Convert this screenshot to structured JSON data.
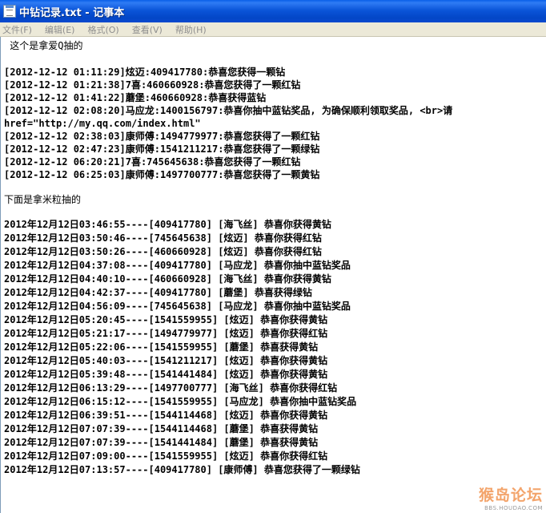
{
  "window": {
    "title": "中钻记录.txt - 记事本"
  },
  "menu": [
    {
      "label": "文件(F)"
    },
    {
      "label": "编辑(E)"
    },
    {
      "label": "格式(O)"
    },
    {
      "label": "查看(V)"
    },
    {
      "label": "帮助(H)"
    }
  ],
  "content": {
    "lines": [
      " 这个是拿爱Q抽的",
      "",
      "[2012-12-12 01:11:29]炫迈:409417780:恭喜您获得一颗钻",
      "[2012-12-12 01:21:38]7喜:460660928:恭喜您获得了一颗红钻",
      "[2012-12-12 01:41:22]蘑堡:460660928:恭喜获得蓝钻",
      "[2012-12-12 02:08:20]马应龙:1400156797:恭喜你抽中蓝钻奖品, 为确保顺利领取奖品, <br>请",
      "href=\"http://my.qq.com/index.html\"",
      "[2012-12-12 02:38:03]康师傅:1494779977:恭喜您获得了一颗红钻",
      "[2012-12-12 02:47:23]康师傅:1541211217:恭喜您获得了一颗绿钻",
      "[2012-12-12 06:20:21]7喜:745645638:恭喜您获得了一颗红钻",
      "[2012-12-12 06:25:03]康师傅:1497700777:恭喜您获得了一颗黄钻",
      "",
      "下面是拿米粒抽的",
      "",
      "2012年12月12日03:46:55----[409417780] [海飞丝] 恭喜你获得黄钻",
      "2012年12月12日03:50:46----[745645638] [炫迈] 恭喜你获得红钻",
      "2012年12月12日03:50:26----[460660928] [炫迈] 恭喜你获得红钻",
      "2012年12月12日04:37:08----[409417780] [马应龙] 恭喜你抽中蓝钻奖品",
      "2012年12月12日04:40:10----[460660928] [海飞丝] 恭喜你获得黄钻",
      "2012年12月12日04:42:37----[409417780] [蘑堡] 恭喜获得绿钻",
      "2012年12月12日04:56:09----[745645638] [马应龙] 恭喜你抽中蓝钻奖品",
      "2012年12月12日05:20:45----[1541559955] [炫迈] 恭喜你获得黄钻",
      "2012年12月12日05:21:17----[1494779977] [炫迈] 恭喜你获得红钻",
      "2012年12月12日05:22:06----[1541559955] [蘑堡] 恭喜获得黄钻",
      "2012年12月12日05:40:03----[1541211217] [炫迈] 恭喜你获得黄钻",
      "2012年12月12日05:39:48----[1541441484] [炫迈] 恭喜你获得黄钻",
      "2012年12月12日06:13:29----[1497700777] [海飞丝] 恭喜你获得红钻",
      "2012年12月12日06:15:12----[1541559955] [马应龙] 恭喜你抽中蓝钻奖品",
      "2012年12月12日06:39:51----[1544114468] [炫迈] 恭喜你获得黄钻",
      "2012年12月12日07:07:39----[1544114468] [蘑堡] 恭喜获得黄钻",
      "2012年12月12日07:07:39----[1541441484] [蘑堡] 恭喜获得黄钻",
      "2012年12月12日07:09:00----[1541559955] [炫迈] 恭喜你获得红钻",
      "2012年12月12日07:13:57----[409417780] [康师傅] 恭喜您获得了一颗绿钻"
    ]
  },
  "watermark": {
    "main": "猴岛论坛",
    "sub": "BBS.HOUDAO.COM"
  },
  "colors": {
    "titlebar": "#0b55d9",
    "menubar": "#ece9d8",
    "text": "#000000",
    "watermark": "#f3a46b"
  }
}
